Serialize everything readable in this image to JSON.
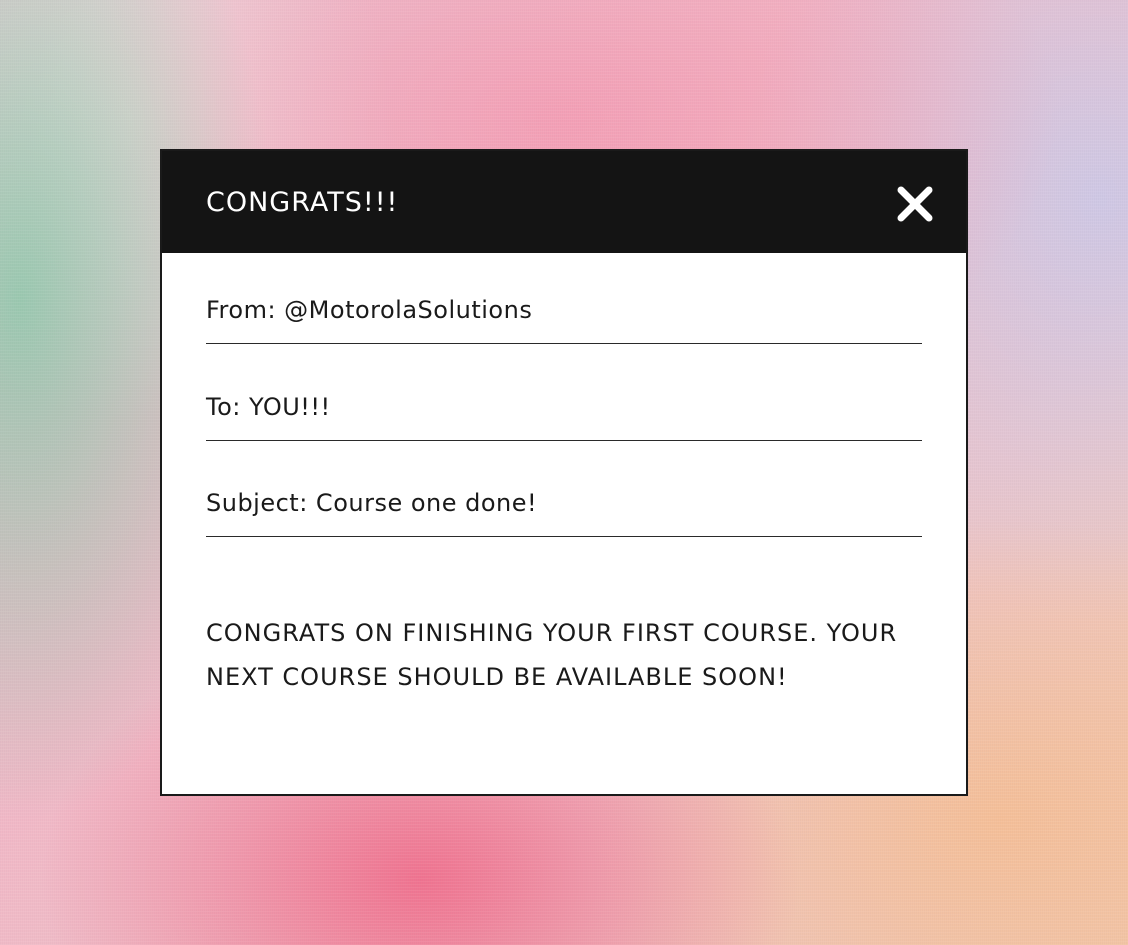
{
  "window": {
    "title": "CONGRATS!!!",
    "close_icon": "close-icon"
  },
  "fields": {
    "from": "From: @MotorolaSolutions",
    "to": "To: YOU!!!",
    "subject": "Subject: Course one done!"
  },
  "message": {
    "body": "CONGRATS ON FINISHING YOUR FIRST COURSE. YOUR NEXT COURSE SHOULD BE AVAILABLE SOON!"
  },
  "colors": {
    "titlebar": "#141414",
    "panel": "#ffffff",
    "text": "#1a1a1a"
  }
}
